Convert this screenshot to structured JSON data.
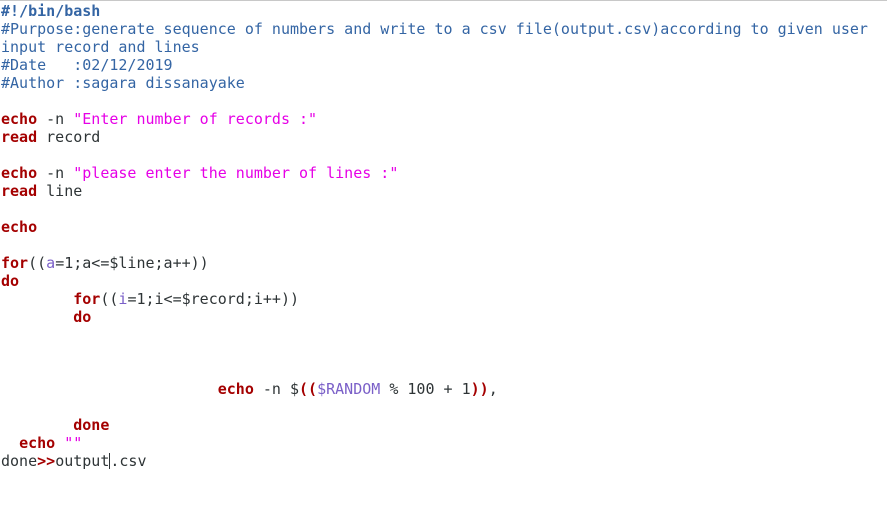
{
  "script": {
    "shebang": "#!/bin/bash",
    "purpose_1": "#Purpose:generate sequence of numbers and write to a csv file(output.csv)according to given user",
    "purpose_2": "input record and lines",
    "date": "#Date   :02/12/2019",
    "author": "#Author :sagara dissanayake",
    "prompt_records": "\"Enter number of records :\"",
    "prompt_lines": "\"please enter the number of lines :\"",
    "var_record": "record",
    "var_line": "line",
    "empty_string": "\"\"",
    "outfile_pre": "output",
    "outfile_post": ".csv"
  },
  "colors": {
    "comment": "#3465a4",
    "keyword": "#a40000",
    "string": "#e600e6",
    "variable": "#7a5fc8",
    "text": "#2e3436"
  }
}
